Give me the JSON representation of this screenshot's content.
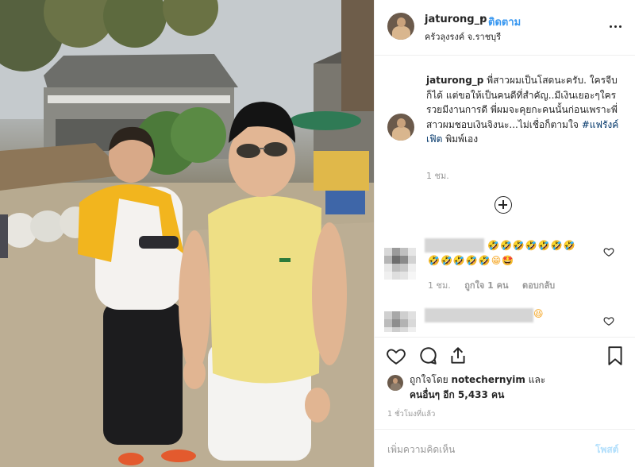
{
  "post": {
    "username": "jaturong_p",
    "separator": "•",
    "follow_label": "ติดตาม",
    "location": "ครัวลุงรงค์ จ.ราชบุรี"
  },
  "caption": {
    "username": "jaturong_p",
    "text": "พี่สาวผมเป็นโสดนะครับ. ใครจีบก็ได้ แต่ขอให้เป็นคนดีที่สำคัญ..มีเงินเยอะๆใครรวยมีงานการดี พี่ผมจะคุยกะคนนั้นก่อนเพราะพี่สาวผมชอบเงินจิงนะ...ไม่เชื่อก็ตามใจ",
    "hashtag": "#แฟรังค์เฟิต",
    "suffix": "พิมพ์เอง",
    "time": "1 ชม."
  },
  "comments": [
    {
      "emojis_line1": "🤣🤣🤣🤣🤣🤣🤣",
      "emojis_line2": "🤣🤣🤣🤣🤣😁🤩",
      "time": "1 ชม.",
      "likes": "ถูกใจ 1 คน",
      "reply": "ตอบกลับ"
    },
    {
      "emojis_line1": "😆"
    }
  ],
  "icons": {
    "more": "more-options-icon",
    "load_more": "plus-circle-icon",
    "like": "heart-icon",
    "comment": "comment-icon",
    "share": "share-icon",
    "save": "bookmark-icon"
  },
  "likes": {
    "prefix": "ถูกใจโดย",
    "user": "notechernyim",
    "connector": "และ",
    "others": "คนอื่นๆ อีก 5,433 คน"
  },
  "posted_ago": "1 ชั่วโมงที่แล้ว",
  "comment_box": {
    "placeholder": "เพิ่มความคิดเห็น",
    "post_label": "โพสต์"
  },
  "colors": {
    "link_blue": "#3897f0",
    "hashtag": "#003569",
    "muted": "#999999",
    "post_disabled": "#b2dffc"
  }
}
